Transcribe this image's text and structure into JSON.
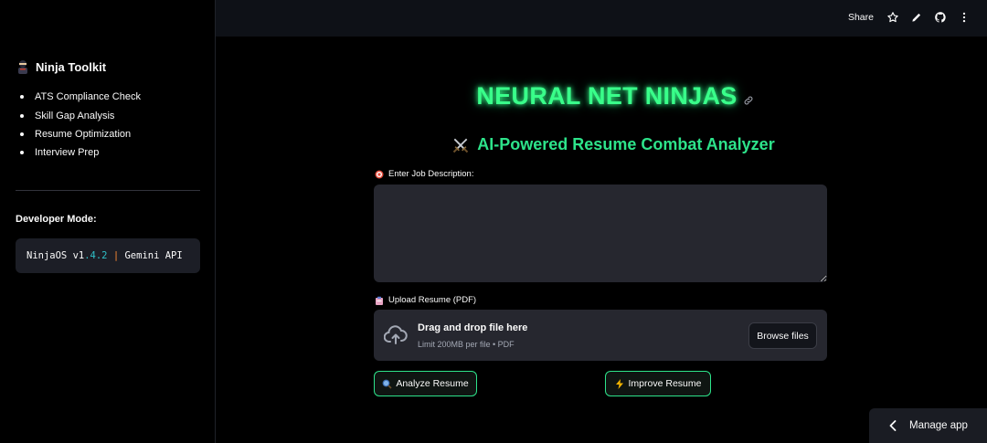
{
  "sidebar": {
    "title": "Ninja Toolkit",
    "items": [
      {
        "label": "ATS Compliance Check"
      },
      {
        "label": "Skill Gap Analysis"
      },
      {
        "label": "Resume Optimization"
      },
      {
        "label": "Interview Prep"
      }
    ],
    "dev_heading": "Developer Mode:",
    "dev_code": {
      "prefix": "NinjaOS v1",
      "version_num": ".4.2",
      "sep": " | ",
      "suffix": "Gemini API"
    }
  },
  "header": {
    "share_label": "Share",
    "icons": [
      "star-icon",
      "pencil-icon",
      "github-icon",
      "more-vert-icon"
    ]
  },
  "main": {
    "title": "NEURAL NET NINJAS",
    "subtitle": "AI-Powered Resume Combat Analyzer",
    "job_desc_label": "Enter Job Description:",
    "job_desc_value": "",
    "upload_label": "Upload Resume (PDF)",
    "drag_text": "Drag and drop file here",
    "limit_text": "Limit 200MB per file • PDF",
    "browse_label": "Browse files",
    "analyze_label": "Analyze Resume",
    "improve_label": "Improve Resume"
  },
  "footer": {
    "manage_label": "Manage app"
  },
  "colors": {
    "accent_green": "#39ff8a",
    "subtitle_green": "#2de38a",
    "input_bg": "#26272f",
    "header_bg": "#0e1117"
  }
}
